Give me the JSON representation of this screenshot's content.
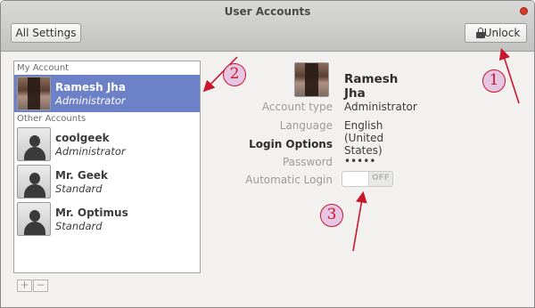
{
  "window": {
    "title": "User Accounts"
  },
  "toolbar": {
    "all_settings_label": "All Settings",
    "unlock_label": "Unlock"
  },
  "sidebar": {
    "my_account_label": "My Account",
    "other_accounts_label": "Other Accounts",
    "accounts": [
      {
        "name": "Ramesh Jha",
        "type": "Administrator",
        "selected": true,
        "avatar": "photo"
      },
      {
        "name": "coolgeek",
        "type": "Administrator",
        "selected": false,
        "avatar": "person-icon"
      },
      {
        "name": "Mr. Geek",
        "type": "Standard",
        "selected": false,
        "avatar": "person-icon"
      },
      {
        "name": "Mr. Optimus",
        "type": "Standard",
        "selected": false,
        "avatar": "person-icon"
      }
    ],
    "add_label": "+",
    "remove_label": "−"
  },
  "details": {
    "name": "Ramesh Jha",
    "account_type_label": "Account type",
    "account_type_value": "Administrator",
    "language_label": "Language",
    "language_value": "English (United States)",
    "login_options_label": "Login Options",
    "password_label": "Password",
    "password_value": "•••••",
    "automatic_login_label": "Automatic Login",
    "automatic_login_state": "OFF"
  },
  "annotations": {
    "callout_1": "1",
    "callout_2": "2",
    "callout_3": "3"
  },
  "colors": {
    "selection": "#6c81c8",
    "annotation": "#c8162c",
    "close": "#d63a2c"
  }
}
